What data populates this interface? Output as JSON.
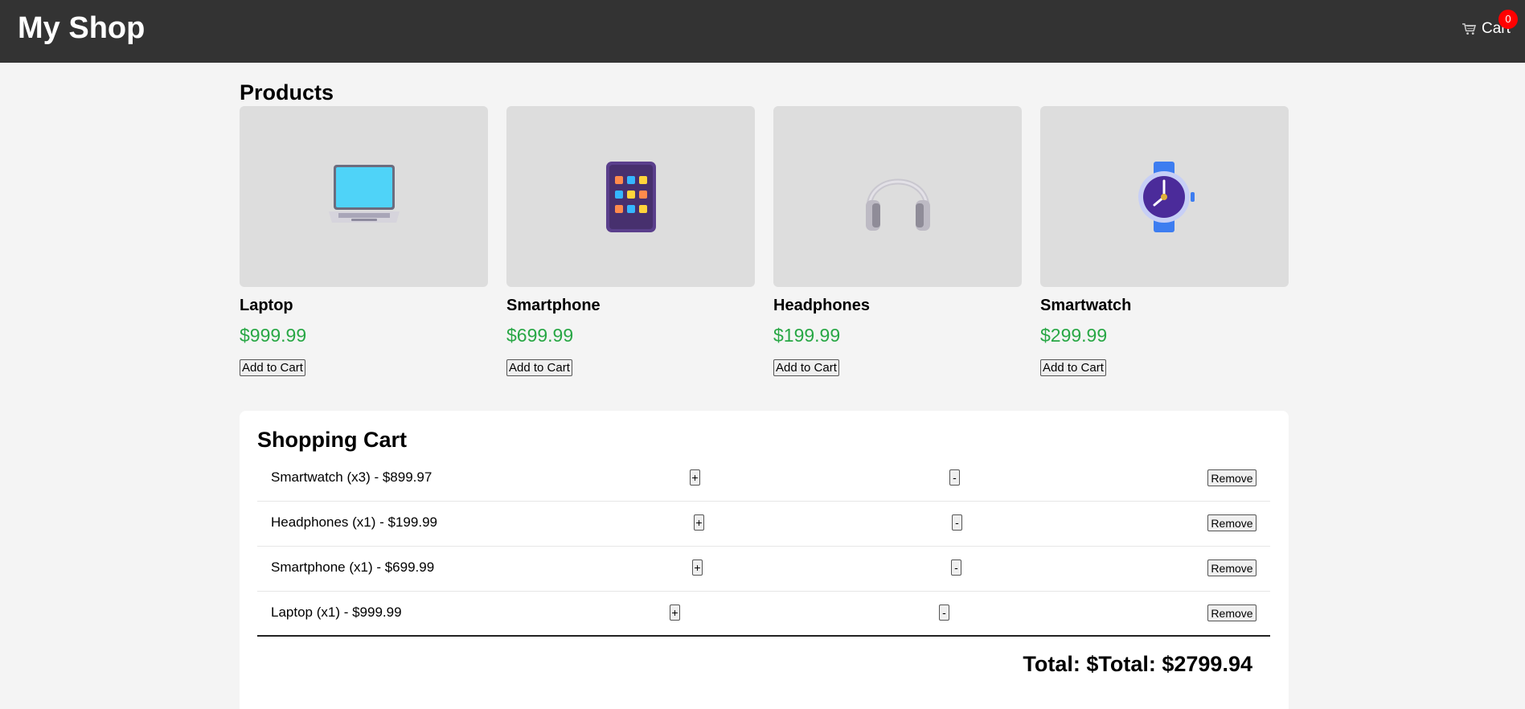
{
  "header": {
    "brand": "My Shop",
    "cart_label": "Cart",
    "cart_icon": "cart-icon",
    "cart_count": "0",
    "colors": {
      "bar": "#333333",
      "badge": "#ff0000"
    }
  },
  "products": {
    "heading": "Products",
    "add_label": "Add to Cart",
    "items": [
      {
        "name": "Laptop",
        "price": "$999.99",
        "icon": "laptop-icon"
      },
      {
        "name": "Smartphone",
        "price": "$699.99",
        "icon": "smartphone-icon"
      },
      {
        "name": "Headphones",
        "price": "$199.99",
        "icon": "headphones-icon"
      },
      {
        "name": "Smartwatch",
        "price": "$299.99",
        "icon": "smartwatch-icon"
      }
    ],
    "price_color": "#28a745"
  },
  "cart": {
    "title": "Shopping Cart",
    "plus_label": "+",
    "minus_label": "-",
    "remove_label": "Remove",
    "rows": [
      {
        "text": "Smartwatch (x3) - $899.97"
      },
      {
        "text": "Headphones (x1) - $199.99"
      },
      {
        "text": "Smartphone (x1) - $699.99"
      },
      {
        "text": "Laptop (x1) - $999.99"
      }
    ],
    "total": "Total: $Total: $2799.94"
  }
}
